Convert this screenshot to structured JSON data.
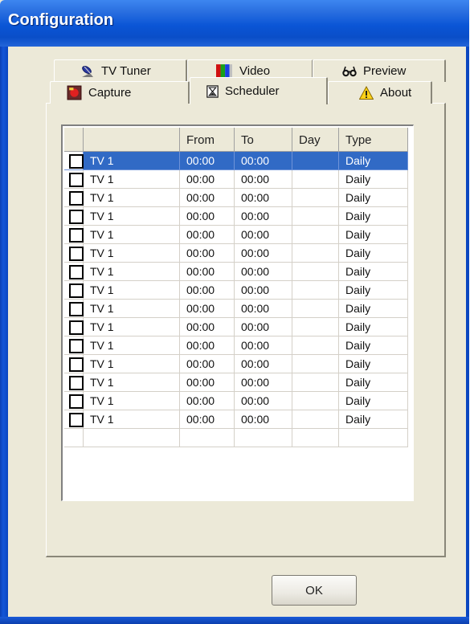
{
  "window": {
    "title": "Configuration"
  },
  "tabs": [
    {
      "label": "TV Tuner",
      "icon": "satellite-dish-icon"
    },
    {
      "label": "Video",
      "icon": "color-bars-icon"
    },
    {
      "label": "Preview",
      "icon": "glasses-icon"
    },
    {
      "label": "Capture",
      "icon": "record-icon"
    },
    {
      "label": "Scheduler",
      "icon": "hourglass-icon",
      "active": true
    },
    {
      "label": "About",
      "icon": "warning-icon"
    }
  ],
  "grid": {
    "columns": [
      "",
      "",
      "From",
      "To",
      "Day",
      "Type"
    ],
    "selected_row": 0,
    "rows": [
      {
        "checked": false,
        "channel": "TV  1",
        "from": "00:00",
        "to": "00:00",
        "day": "",
        "type": "Daily"
      },
      {
        "checked": false,
        "channel": "TV  1",
        "from": "00:00",
        "to": "00:00",
        "day": "",
        "type": "Daily"
      },
      {
        "checked": false,
        "channel": "TV  1",
        "from": "00:00",
        "to": "00:00",
        "day": "",
        "type": "Daily"
      },
      {
        "checked": false,
        "channel": "TV  1",
        "from": "00:00",
        "to": "00:00",
        "day": "",
        "type": "Daily"
      },
      {
        "checked": false,
        "channel": "TV  1",
        "from": "00:00",
        "to": "00:00",
        "day": "",
        "type": "Daily"
      },
      {
        "checked": false,
        "channel": "TV  1",
        "from": "00:00",
        "to": "00:00",
        "day": "",
        "type": "Daily"
      },
      {
        "checked": false,
        "channel": "TV  1",
        "from": "00:00",
        "to": "00:00",
        "day": "",
        "type": "Daily"
      },
      {
        "checked": false,
        "channel": "TV  1",
        "from": "00:00",
        "to": "00:00",
        "day": "",
        "type": "Daily"
      },
      {
        "checked": false,
        "channel": "TV  1",
        "from": "00:00",
        "to": "00:00",
        "day": "",
        "type": "Daily"
      },
      {
        "checked": false,
        "channel": "TV  1",
        "from": "00:00",
        "to": "00:00",
        "day": "",
        "type": "Daily"
      },
      {
        "checked": false,
        "channel": "TV  1",
        "from": "00:00",
        "to": "00:00",
        "day": "",
        "type": "Daily"
      },
      {
        "checked": false,
        "channel": "TV  1",
        "from": "00:00",
        "to": "00:00",
        "day": "",
        "type": "Daily"
      },
      {
        "checked": false,
        "channel": "TV  1",
        "from": "00:00",
        "to": "00:00",
        "day": "",
        "type": "Daily"
      },
      {
        "checked": false,
        "channel": "TV  1",
        "from": "00:00",
        "to": "00:00",
        "day": "",
        "type": "Daily"
      },
      {
        "checked": false,
        "channel": "TV  1",
        "from": "00:00",
        "to": "00:00",
        "day": "",
        "type": "Daily"
      }
    ],
    "empty_rows": 1
  },
  "buttons": {
    "ok": "OK"
  },
  "colors": {
    "title_bar": "#0a55d6",
    "selection": "#316ac5",
    "dialog_bg": "#ece9d8"
  }
}
